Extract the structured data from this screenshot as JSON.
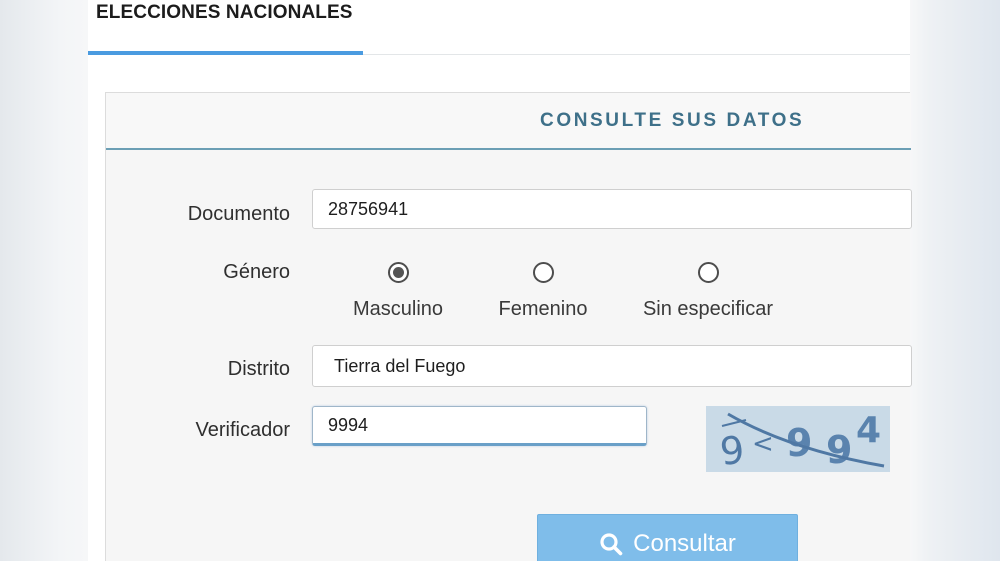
{
  "tab": {
    "label": "ELECCIONES NACIONALES"
  },
  "panel": {
    "title": "CONSULTE SUS DATOS"
  },
  "form": {
    "documento": {
      "label": "Documento",
      "value": "28756941"
    },
    "genero": {
      "label": "Género",
      "options": [
        {
          "label": "Masculino",
          "checked": true
        },
        {
          "label": "Femenino",
          "checked": false
        },
        {
          "label": "Sin especificar",
          "checked": false
        }
      ]
    },
    "distrito": {
      "label": "Distrito",
      "value": "Tierra del Fuego"
    },
    "verificador": {
      "label": "Verificador",
      "value": "9994"
    }
  },
  "captcha": {
    "text": "9994"
  },
  "submit": {
    "label": "Consultar",
    "icon": "search-icon"
  },
  "colors": {
    "accent": "#4a9be0",
    "title": "#3e7089",
    "button": "#7fbdea"
  }
}
